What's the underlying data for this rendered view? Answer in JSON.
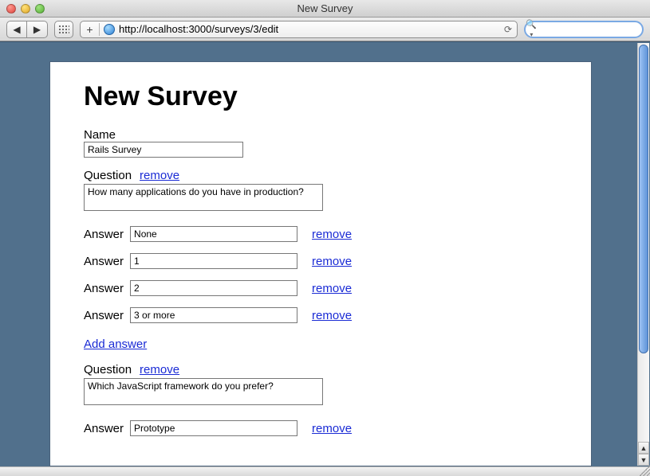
{
  "window": {
    "title": "New Survey"
  },
  "toolbar": {
    "url": "http://localhost:3000/surveys/3/edit",
    "search_placeholder": ""
  },
  "page": {
    "heading": "New Survey",
    "labels": {
      "name": "Name",
      "question": "Question",
      "answer": "Answer",
      "remove": "remove",
      "add_answer": "Add answer"
    },
    "name_value": "Rails Survey",
    "questions": [
      {
        "text": "How many applications do you have in production?",
        "answers": [
          "None",
          "1",
          "2",
          "3 or more"
        ]
      },
      {
        "text": "Which JavaScript framework do you prefer?",
        "answers": [
          "Prototype"
        ]
      }
    ]
  }
}
